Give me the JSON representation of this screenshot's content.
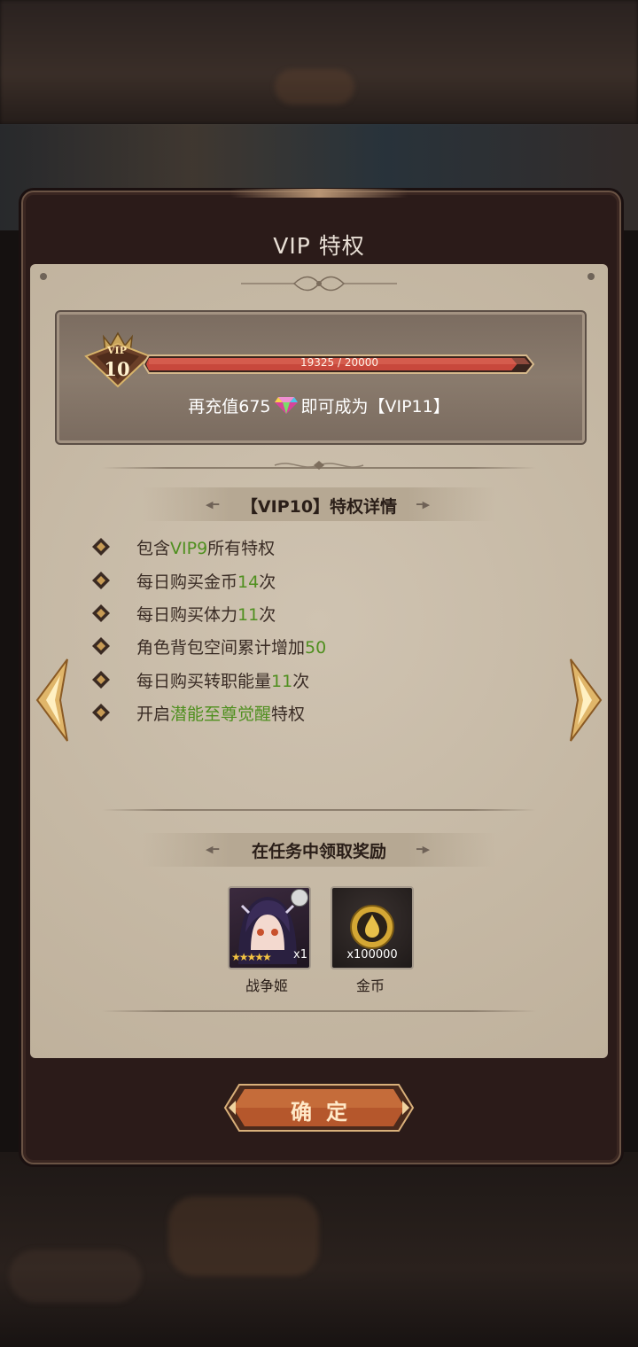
{
  "title": "VIP 特权",
  "vip": {
    "badge_text": "VIP",
    "level": "10",
    "progress_text": "19325 / 20000",
    "progress_current": 19325,
    "progress_max": 20000
  },
  "recharge": {
    "prefix": "再充值675",
    "suffix": "即可成为【VIP11】"
  },
  "privileges_title": "【VIP10】特权详情",
  "privileges": [
    {
      "parts": [
        {
          "t": "包含",
          "g": false
        },
        {
          "t": "VIP9",
          "g": true
        },
        {
          "t": "所有特权",
          "g": false
        }
      ]
    },
    {
      "parts": [
        {
          "t": "每日购买金币",
          "g": false
        },
        {
          "t": "14",
          "g": true
        },
        {
          "t": "次",
          "g": false
        }
      ]
    },
    {
      "parts": [
        {
          "t": "每日购买体力",
          "g": false
        },
        {
          "t": "11",
          "g": true
        },
        {
          "t": "次",
          "g": false
        }
      ]
    },
    {
      "parts": [
        {
          "t": "角色背包空间累计增加",
          "g": false
        },
        {
          "t": "50",
          "g": true
        }
      ]
    },
    {
      "parts": [
        {
          "t": "每日购买转职能量",
          "g": false
        },
        {
          "t": "11",
          "g": true
        },
        {
          "t": "次",
          "g": false
        }
      ]
    },
    {
      "parts": [
        {
          "t": "开启",
          "g": false
        },
        {
          "t": "潜能至尊觉醒",
          "g": true
        },
        {
          "t": "特权",
          "g": false
        }
      ]
    }
  ],
  "rewards_title": "在任务中领取奖励",
  "rewards": [
    {
      "name": "战争姬",
      "count": "x1",
      "stars": 5,
      "icon": "character-portrait"
    },
    {
      "name": "金币",
      "count": "x100000",
      "icon": "gold-coin-icon"
    }
  ],
  "confirm_label": "确定",
  "colors": {
    "highlight_green": "#4f8f1f",
    "bar_fill": "#c8483c",
    "panel": "#c8bba8"
  }
}
